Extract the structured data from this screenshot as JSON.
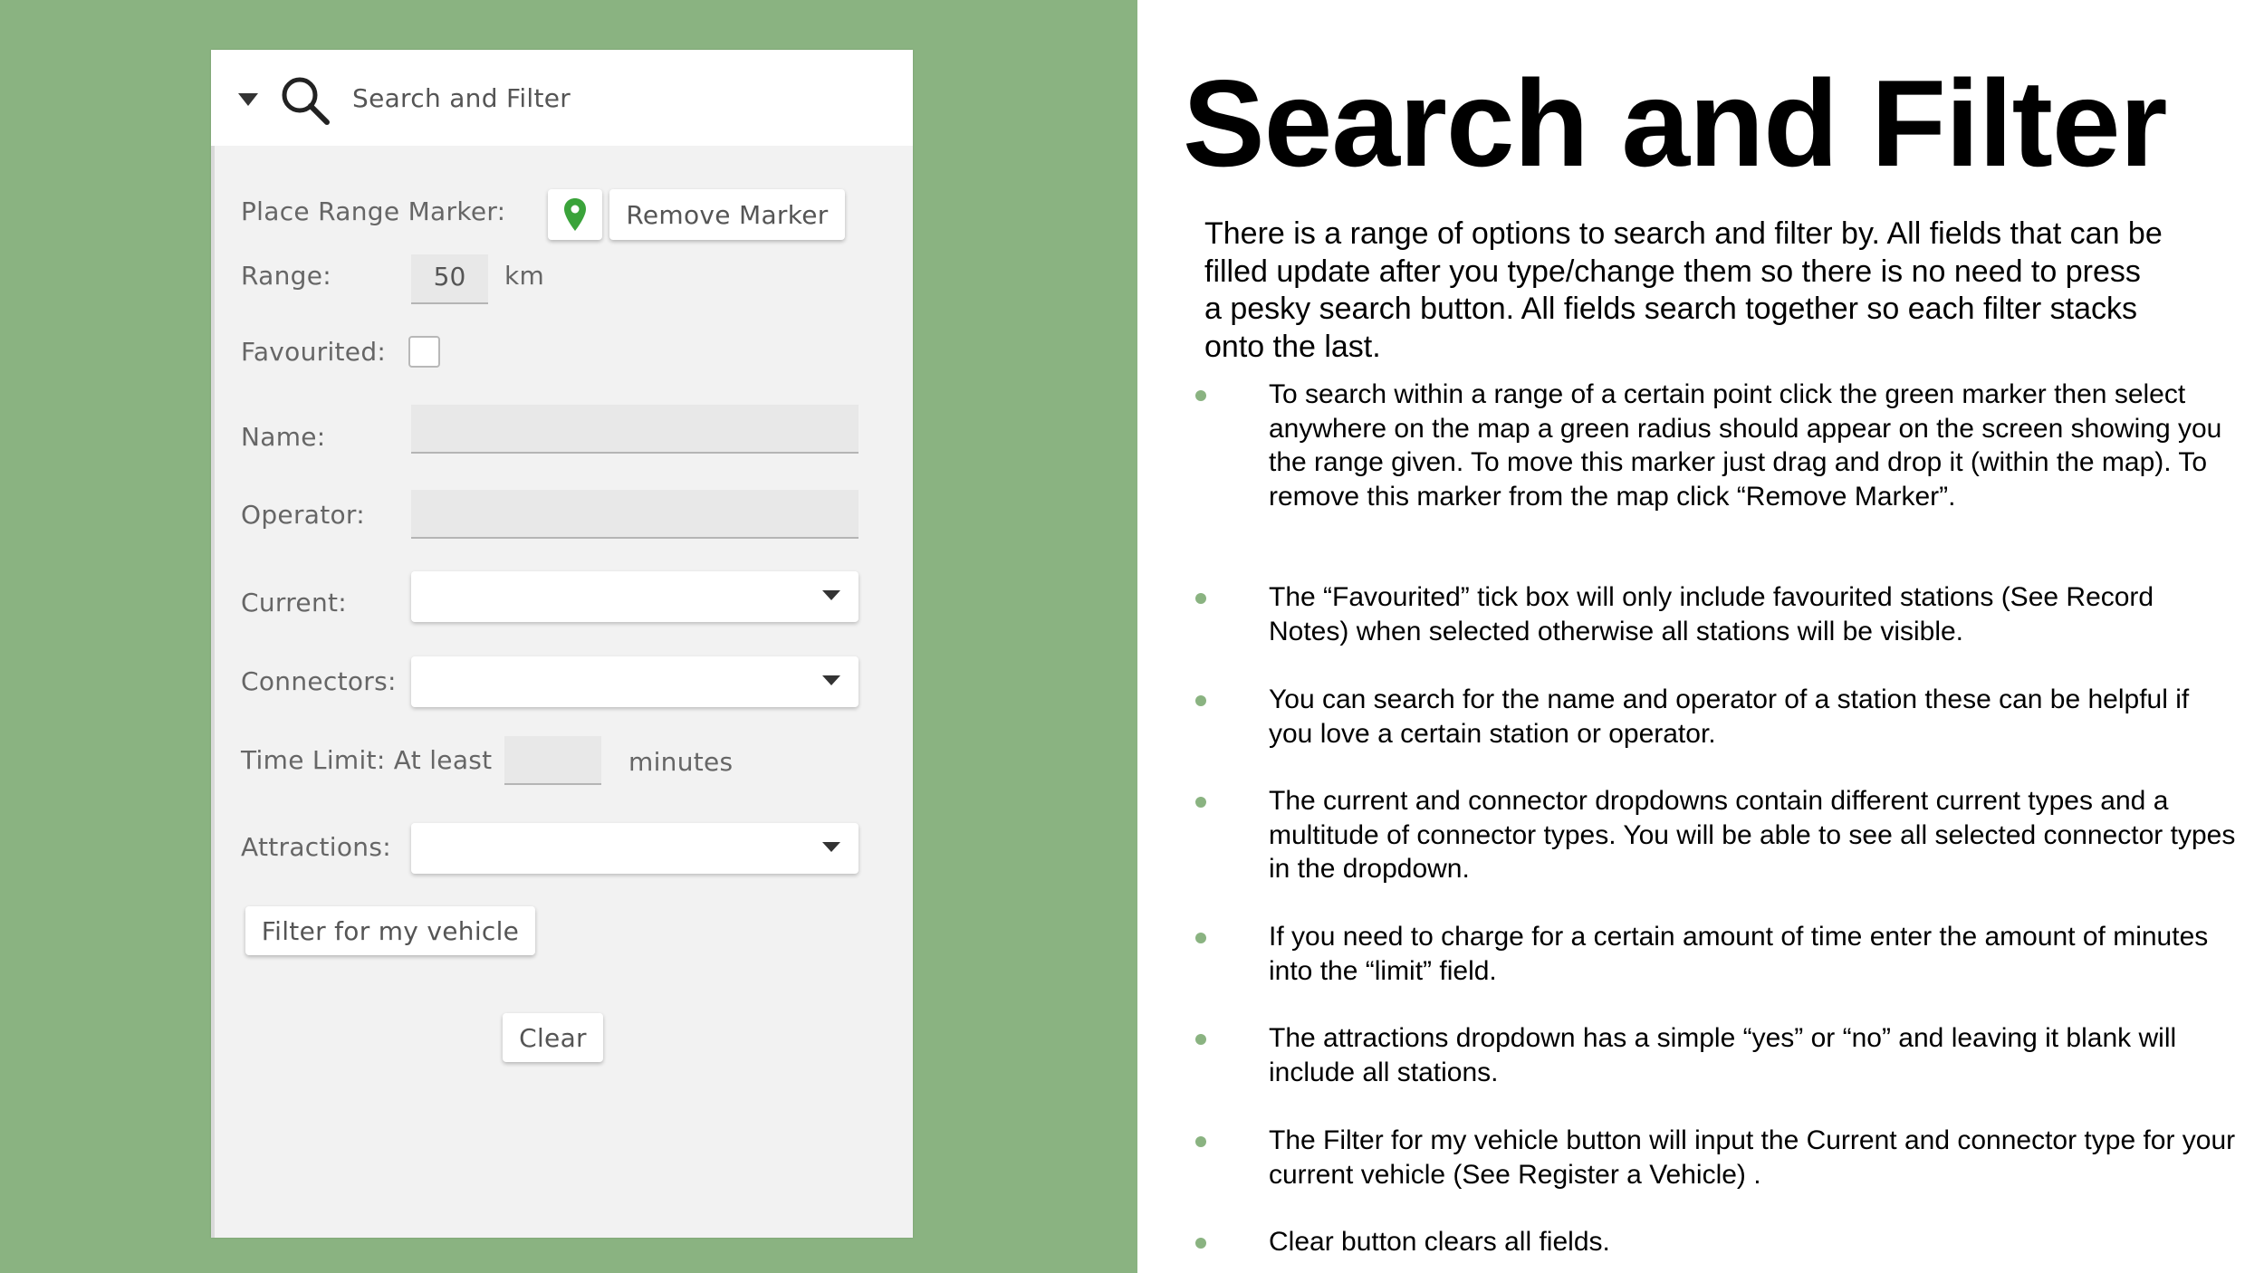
{
  "colors": {
    "background_left": "#8ab381",
    "panel_bg": "#f2f2f2",
    "marker_green": "#3aa33a",
    "bullet": "#8ab381"
  },
  "panel": {
    "title": "Search and Filter",
    "collapse_icon": "triangle-down-icon",
    "search_icon": "magnifier-icon",
    "place_range_label": "Place Range Marker:",
    "marker_icon": "map-pin-icon",
    "remove_marker": "Remove Marker",
    "range_label": "Range:",
    "range_value": "50",
    "range_unit": "km",
    "favourited_label": "Favourited:",
    "favourited_checked": false,
    "name_label": "Name:",
    "name_value": "",
    "operator_label": "Operator:",
    "operator_value": "",
    "current_label": "Current:",
    "current_value": "",
    "connectors_label": "Connectors:",
    "connectors_value": "",
    "time_limit_label": "Time Limit: At least",
    "time_limit_value": "",
    "time_limit_unit": "minutes",
    "attractions_label": "Attractions:",
    "attractions_value": "",
    "filter_vehicle": "Filter for my vehicle",
    "clear": "Clear"
  },
  "slide": {
    "title": "Search and Filter",
    "intro": "There is a range of options to search and filter by. All fields that can be filled update after you type/change them so there is no need to press a pesky search button. All fields search together so each filter stacks onto the last.",
    "bullets": [
      "To search within a range of a certain point click the green marker then select anywhere on the map a green radius should appear on the screen showing you the range given. To move this marker just drag and drop it (within the map). To remove this marker from the map click “Remove Marker”.",
      "The “Favourited” tick box will only include favourited stations (See Record Notes) when selected otherwise all stations will be visible.",
      "You can search for the name and operator of a station these can be helpful if you love a certain station or operator.",
      "The current and connector dropdowns contain different current types and a multitude of connector types. You will be able to see all selected connector types in the dropdown.",
      "If you need to charge for a certain amount of time enter the amount of minutes into the “limit” field.",
      "The attractions dropdown has a simple “yes” or “no” and leaving it blank will include all stations.",
      "The Filter for my vehicle button will input the Current and connector type for your current vehicle (See Register a Vehicle) .",
      "Clear button clears all fields."
    ]
  }
}
